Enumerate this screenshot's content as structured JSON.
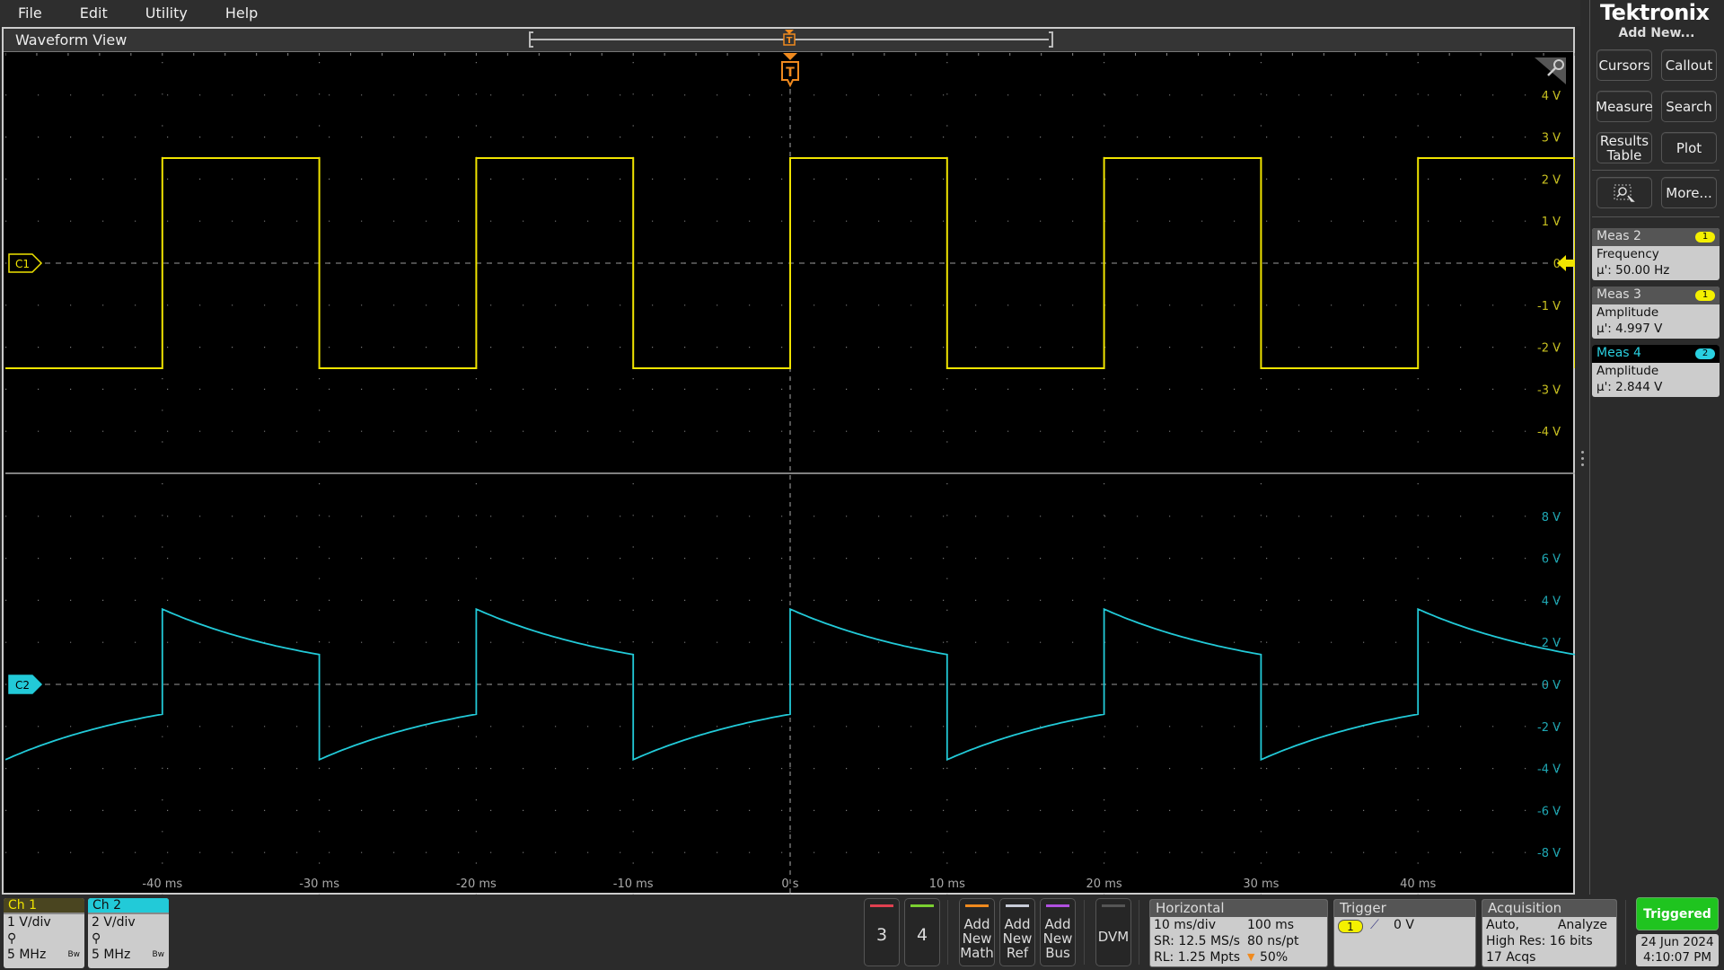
{
  "menu": [
    "File",
    "Edit",
    "Utility",
    "Help"
  ],
  "waveform_view": {
    "title": "Waveform View",
    "trigger_marker": "T"
  },
  "brand": "Tektronix",
  "right_panel": {
    "add_new": "Add New...",
    "buttons": {
      "cursors": "Cursors",
      "callout": "Callout",
      "measure": "Measure",
      "search": "Search",
      "results_table_1": "Results",
      "results_table_2": "Table",
      "plot": "Plot",
      "more": "More..."
    },
    "measurements": [
      {
        "name": "Meas 2",
        "source": "1",
        "type": "Frequency",
        "value": "µ': 50.00 Hz",
        "badge_color": "#f4f000"
      },
      {
        "name": "Meas 3",
        "source": "1",
        "type": "Amplitude",
        "value": "µ': 4.997 V",
        "badge_color": "#f4f000"
      },
      {
        "name": "Meas 4",
        "source": "2",
        "type": "Amplitude",
        "value": "µ': 2.844 V",
        "badge_color": "#2ad0e0"
      }
    ]
  },
  "channels": [
    {
      "label": "Ch 1",
      "scale": "1 V/div",
      "bw": "5 MHz",
      "bw_tag": "Bw",
      "marker": "C1",
      "color": "#f0e400"
    },
    {
      "label": "Ch 2",
      "scale": "2 V/div",
      "bw": "5 MHz",
      "bw_tag": "Bw",
      "marker": "C2",
      "color": "#22cad8"
    }
  ],
  "bottom_buttons": {
    "ch3": "3",
    "ch4": "4",
    "math": [
      "Add",
      "New",
      "Math"
    ],
    "ref": [
      "Add",
      "New",
      "Ref"
    ],
    "bus": [
      "Add",
      "New",
      "Bus"
    ],
    "dvm": "DVM"
  },
  "horizontal": {
    "title": "Horizontal",
    "scale": "10 ms/div",
    "duration": "100 ms",
    "sr": "SR: 12.5 MS/s",
    "res": "80 ns/pt",
    "rl": "RL: 1.25 Mpts",
    "position": "50%"
  },
  "trigger": {
    "title": "Trigger",
    "source": "1",
    "level": "0 V"
  },
  "acquisition": {
    "title": "Acquisition",
    "mode": "Auto,",
    "analyze": "Analyze",
    "highres": "High Res: 16 bits",
    "acqs": "17 Acqs"
  },
  "status": {
    "triggered": "Triggered",
    "date": "24 Jun 2024",
    "time": "4:10:07 PM"
  },
  "chart_data": {
    "type": "line",
    "x_range_ms": [
      -50,
      50
    ],
    "x_ticks": [
      "-40 ms",
      "-30 ms",
      "-20 ms",
      "-10 ms",
      "0 s",
      "10 ms",
      "20 ms",
      "30 ms",
      "40 ms"
    ],
    "x_tick_values": [
      -40,
      -30,
      -20,
      -10,
      0,
      10,
      20,
      30,
      40
    ],
    "grid": true,
    "panes": [
      {
        "channel": "Ch 1",
        "ylim": [
          -5,
          5
        ],
        "y_ticks": [
          "4 V",
          "3 V",
          "2 V",
          "1 V",
          "0",
          "-1 V",
          "-2 V",
          "-3 V",
          "-4 V"
        ],
        "y_tick_values": [
          4,
          3,
          2,
          1,
          0,
          -1,
          -2,
          -3,
          -4
        ],
        "series": {
          "shape": "square",
          "high": 2.5,
          "low": -2.5,
          "period_ms": 20,
          "rising_edges_ms": [
            -40,
            -20,
            0,
            20,
            40
          ]
        }
      },
      {
        "channel": "Ch 2",
        "ylim": [
          -10,
          10
        ],
        "y_ticks": [
          "8 V",
          "6 V",
          "4 V",
          "2 V",
          "0 V",
          "-2 V",
          "-4 V",
          "-6 V",
          "-8 V"
        ],
        "y_tick_values": [
          8,
          6,
          4,
          2,
          0,
          -2,
          -4,
          -6,
          -8
        ],
        "series": {
          "shape": "rc-decay",
          "peak": 3.58,
          "end": 1.42,
          "period_ms": 20,
          "rising_edges_ms": [
            -40,
            -20,
            0,
            20,
            40
          ]
        }
      }
    ]
  }
}
